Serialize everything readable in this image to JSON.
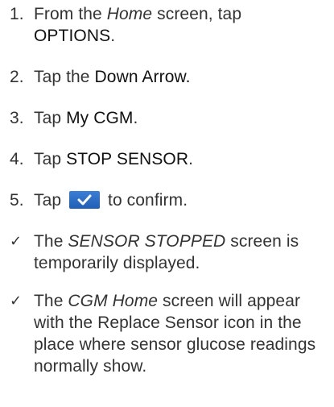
{
  "steps": [
    {
      "number": "1.",
      "prefix": "From the ",
      "italic": "Home",
      "middle": " screen, tap",
      "strong": "OPTIONS",
      "suffix": "."
    },
    {
      "number": "2.",
      "prefix": "Tap the ",
      "strong": "Down Arrow."
    },
    {
      "number": "3.",
      "prefix": "Tap ",
      "strong": "My CGM",
      "suffix": "."
    },
    {
      "number": "4.",
      "prefix": "Tap ",
      "strong": "STOP SENSOR",
      "suffix": "."
    },
    {
      "number": "5.",
      "prefix": "Tap ",
      "icon": "confirm-checkmark-icon",
      "suffix": " to confirm."
    }
  ],
  "results": [
    {
      "marker": "✓",
      "prefix": "The ",
      "italic": "SENSOR STOPPED",
      "suffix": " screen is temporarily displayed."
    },
    {
      "marker": "✓",
      "prefix": "The ",
      "italic": "CGM Home",
      "suffix": " screen will appear with the Replace Sensor icon in the place where sensor glucose readings normally show."
    }
  ],
  "colors": {
    "text": "#333333",
    "icon_blue": "#2a6fc9"
  }
}
